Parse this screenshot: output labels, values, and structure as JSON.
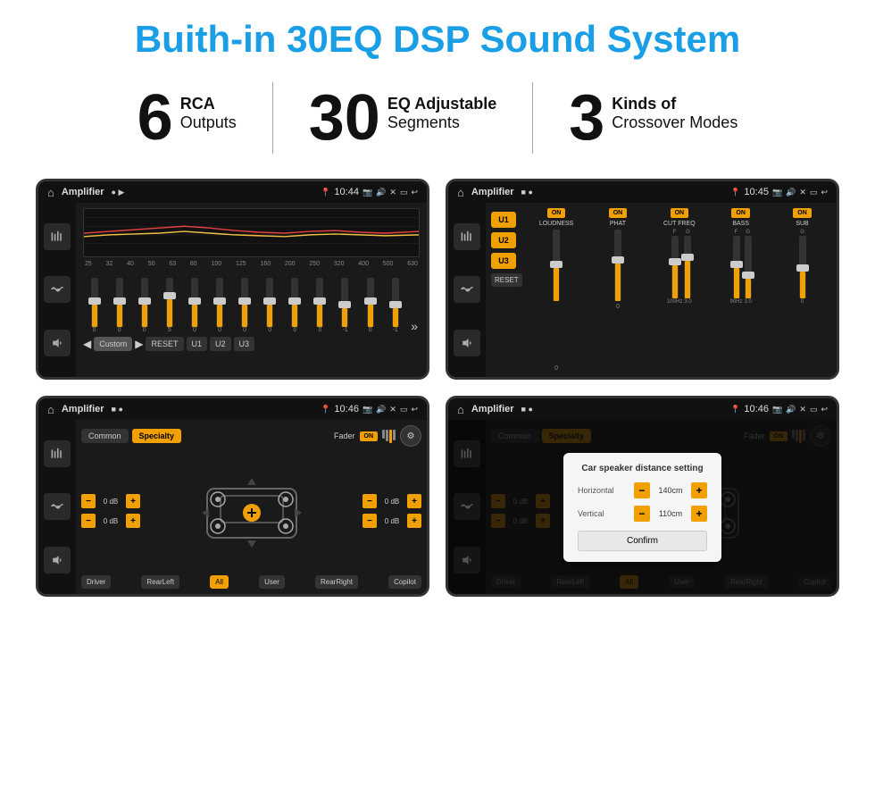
{
  "header": {
    "title": "Buith-in 30EQ DSP Sound System"
  },
  "stats": [
    {
      "number": "6",
      "line1": "RCA",
      "line2": "Outputs"
    },
    {
      "number": "30",
      "line1": "EQ Adjustable",
      "line2": "Segments"
    },
    {
      "number": "3",
      "line1": "Kinds of",
      "line2": "Crossover Modes"
    }
  ],
  "screens": [
    {
      "name": "eq-screen",
      "status": {
        "app": "Amplifier",
        "time": "10:44"
      },
      "type": "eq",
      "freq_labels": [
        "25",
        "32",
        "40",
        "50",
        "63",
        "80",
        "100",
        "125",
        "160",
        "200",
        "250",
        "320",
        "400",
        "500",
        "630"
      ],
      "slider_values": [
        "0",
        "0",
        "0",
        "5",
        "0",
        "0",
        "0",
        "0",
        "0",
        "0",
        "-1",
        "0",
        "-1"
      ],
      "nav_buttons": [
        "Custom",
        "RESET",
        "U1",
        "U2",
        "U3"
      ]
    },
    {
      "name": "crossover-screen",
      "status": {
        "app": "Amplifier",
        "time": "10:45"
      },
      "type": "crossover",
      "presets": [
        "U1",
        "U2",
        "U3"
      ],
      "channels": [
        {
          "label": "LOUDNESS",
          "toggle": "ON"
        },
        {
          "label": "PHAT",
          "toggle": "ON"
        },
        {
          "label": "CUT FREQ",
          "toggle": "ON"
        },
        {
          "label": "BASS",
          "toggle": "ON"
        },
        {
          "label": "SUB",
          "toggle": "ON"
        }
      ],
      "reset_label": "RESET"
    },
    {
      "name": "speaker-screen",
      "status": {
        "app": "Amplifier",
        "time": "10:46"
      },
      "type": "speaker",
      "tabs": [
        "Common",
        "Specialty"
      ],
      "active_tab": "Specialty",
      "fader_label": "Fader",
      "fader_toggle": "ON",
      "db_values": [
        "0 dB",
        "0 dB",
        "0 dB",
        "0 dB"
      ],
      "footer_btns": [
        "Driver",
        "RearLeft",
        "All",
        "User",
        "RearRight",
        "Copilot"
      ]
    },
    {
      "name": "dialog-screen",
      "status": {
        "app": "Amplifier",
        "time": "10:46"
      },
      "type": "speaker-dialog",
      "tabs": [
        "Common",
        "Specialty"
      ],
      "active_tab": "Specialty",
      "fader_label": "Fader",
      "fader_toggle": "ON",
      "dialog": {
        "title": "Car speaker distance setting",
        "horizontal_label": "Horizontal",
        "horizontal_value": "140cm",
        "vertical_label": "Vertical",
        "vertical_value": "110cm",
        "confirm_label": "Confirm"
      },
      "db_values": [
        "0 dB",
        "0 dB"
      ],
      "footer_btns": [
        "Driver",
        "RearLeft",
        "All",
        "User",
        "RearRight",
        "Copilot"
      ]
    }
  ]
}
